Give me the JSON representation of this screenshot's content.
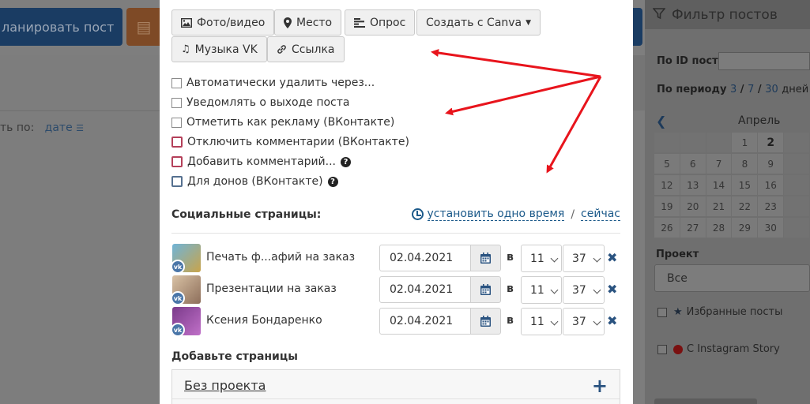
{
  "background": {
    "plan_button": "ланировать пост",
    "sort_label": "ть по:",
    "sort_value": "дате"
  },
  "filter_panel": {
    "title": "Фильтр постов",
    "post_id_label": "По ID поста",
    "period_label": "По периоду",
    "period_3": "3",
    "period_7": "7",
    "period_30": "30",
    "period_unit": "дней",
    "month": "Апрель",
    "calendar": [
      [
        "",
        "",
        "",
        "1",
        "2",
        ""
      ],
      [
        "5",
        "6",
        "7",
        "8",
        "9",
        ""
      ],
      [
        "12",
        "13",
        "14",
        "15",
        "16",
        ""
      ],
      [
        "19",
        "20",
        "21",
        "22",
        "23",
        ""
      ],
      [
        "26",
        "27",
        "28",
        "29",
        "30",
        ""
      ]
    ],
    "project_label": "Проект",
    "project_value": "Все",
    "favorites_label": "Избранные посты",
    "instagram_label": "С Instagram Story"
  },
  "toolbar": {
    "photo_video": "Фото/видео",
    "place": "Место",
    "poll": "Опрос",
    "canva": "Создать с Canva",
    "music": "Музыка VK",
    "link": "Ссылка"
  },
  "options": [
    {
      "label": "Автоматически удалить через...",
      "style": "plain",
      "help": false
    },
    {
      "label": "Уведомлять о выходе поста",
      "style": "plain",
      "help": false
    },
    {
      "label": "Отметить как рекламу (ВКонтакте)",
      "style": "plain",
      "help": false
    },
    {
      "label": "Отключить комментарии (ВКонтакте)",
      "style": "red",
      "help": false
    },
    {
      "label": "Добавить комментарий...",
      "style": "red",
      "help": true
    },
    {
      "label": "Для донов (ВКонтакте)",
      "style": "blue",
      "help": true
    }
  ],
  "social": {
    "title": "Социальные страницы:",
    "set_one_time": "установить одно время",
    "separator": "/",
    "now": "сейчас",
    "pages": [
      {
        "name": "Печать ф...афий на заказ",
        "date": "02.04.2021",
        "at": "в",
        "hour": "11",
        "minute": "37"
      },
      {
        "name": "Презентации на заказ",
        "date": "02.04.2021",
        "at": "в",
        "hour": "11",
        "minute": "37"
      },
      {
        "name": "Ксения Бондаренко",
        "date": "02.04.2021",
        "at": "в",
        "hour": "11",
        "minute": "37"
      }
    ]
  },
  "add_pages": {
    "title": "Добавьте страницы",
    "no_project": "Без проекта"
  },
  "colors": {
    "accent_blue": "#2a5380",
    "link_blue": "#1c5a8a",
    "arrow_red": "#e8141c",
    "vk_blue": "#4a76a8"
  }
}
